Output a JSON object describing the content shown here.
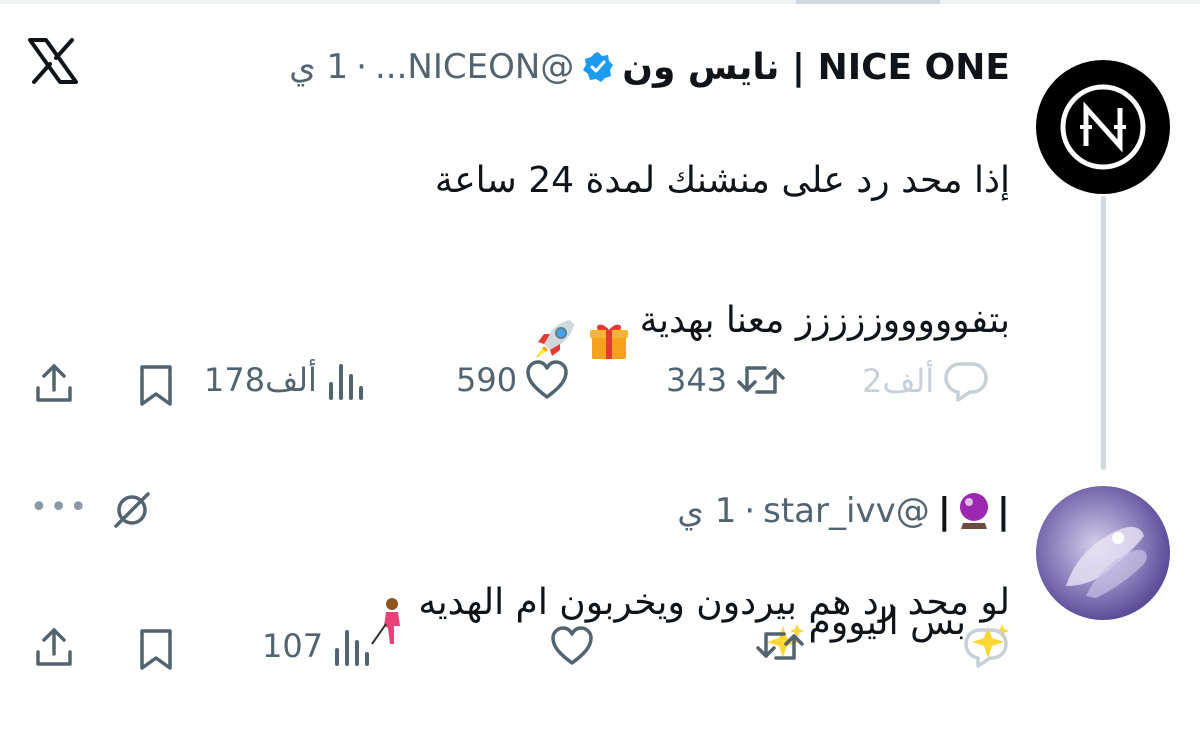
{
  "tweet_main": {
    "display_name": "NICE ONE | نايس ون",
    "handle": "@NICEON...",
    "separator": "·",
    "time": "1 ي",
    "body_lines": [
      "إذا محد رد على منشنك لمدة 24 ساعة",
      "بتفوووووززززز معنا بهدية",
      "",
      "بس اليووم"
    ],
    "actions": {
      "replies": "2ألف",
      "retweets": "343",
      "likes": "590",
      "views": "178ألف"
    }
  },
  "tweet_reply": {
    "display_name": "|  |",
    "handle": "@star_ivv",
    "separator": "·",
    "time": "1 ي",
    "body": "لو محد رد هم بيردون ويخربون ام الهديه",
    "more": "•••",
    "actions": {
      "views": "107"
    }
  },
  "icons": {
    "app_logo": "x-logo-icon",
    "verified": "verified-badge-icon",
    "reply": "reply-icon",
    "retweet": "retweet-icon",
    "like": "heart-icon",
    "views": "views-icon",
    "bookmark": "bookmark-icon",
    "share": "share-icon",
    "mute": "mute-icon"
  },
  "colors": {
    "text": "#0f1419",
    "muted": "#536471",
    "verified": "#1d9bf0",
    "thread_line": "#cfd9de"
  }
}
